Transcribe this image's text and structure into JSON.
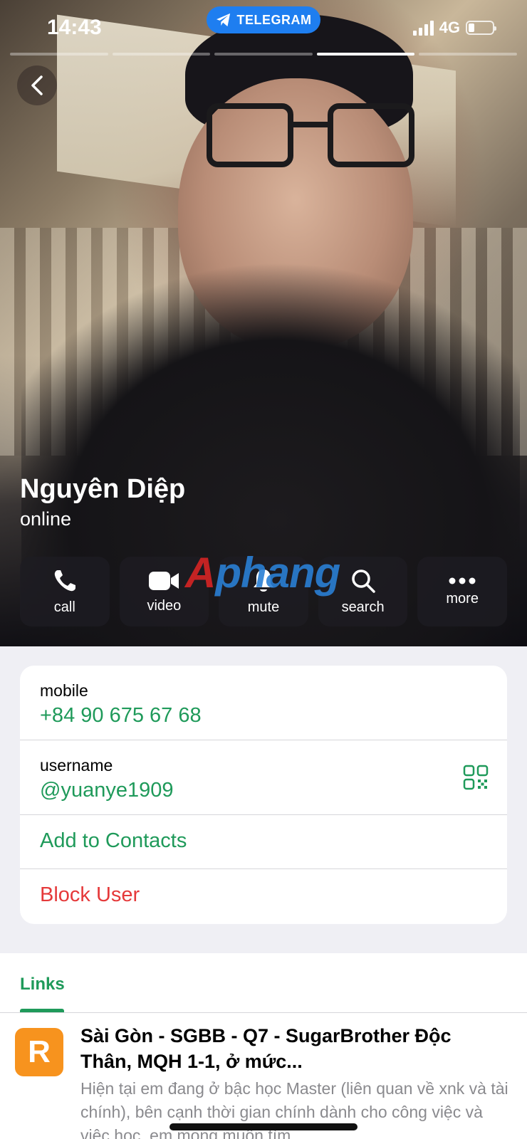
{
  "status_bar": {
    "time": "14:43",
    "app_pill": "TELEGRAM",
    "network": "4G",
    "battery_level": 0.25
  },
  "profile": {
    "name": "Nguyên Diệp",
    "presence": "online",
    "story_segments": 5,
    "active_segment": 3
  },
  "actions": [
    {
      "label": "call",
      "icon": "phone-icon"
    },
    {
      "label": "video",
      "icon": "video-camera-icon"
    },
    {
      "label": "mute",
      "icon": "bell-icon"
    },
    {
      "label": "search",
      "icon": "search-icon"
    },
    {
      "label": "more",
      "icon": "more-dots-icon"
    }
  ],
  "watermark": "Aphang",
  "info": {
    "mobile_caption": "mobile",
    "mobile_value": "+84 90 675 67 68",
    "username_caption": "username",
    "username_value": "@yuanye1909",
    "add_contact": "Add to Contacts",
    "block_user": "Block User"
  },
  "links": {
    "tab_title": "Links",
    "item": {
      "icon_letter": "R",
      "title": "Sài Gòn - SGBB - Q7 - SugarBrother Độc Thân, MQH 1-1, ở mức...",
      "description": "Hiện tại em đang ở bậc học Master (liên quan về xnk và tài chính), bên cạnh thời gian chính dành cho công việc và việc học, em mong muốn tìm"
    }
  },
  "colors": {
    "accent_green": "#1f9a5a",
    "destructive_red": "#e5393a",
    "telegram_blue": "#1e7ef0",
    "link_icon_orange": "#f7931e"
  }
}
